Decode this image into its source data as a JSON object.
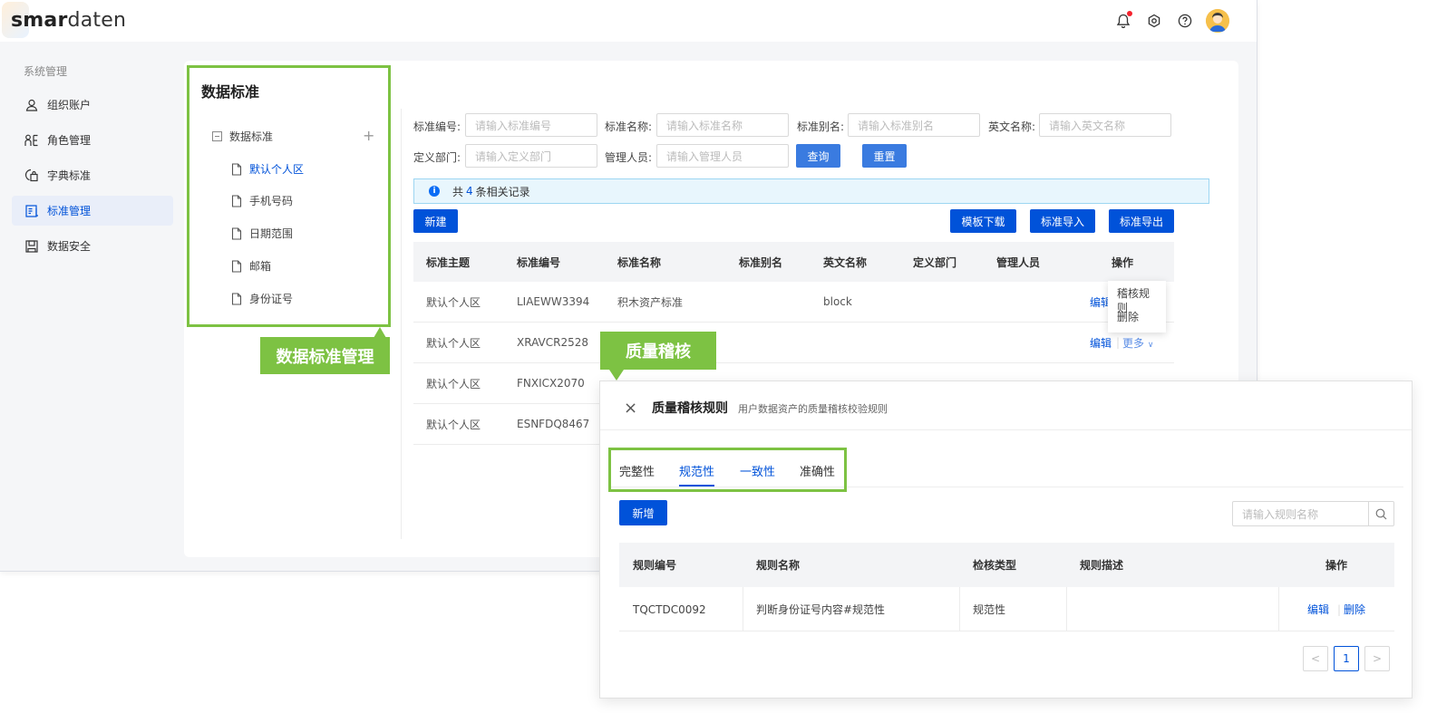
{
  "app": {
    "logo_bold": "sm",
    "logo_mid": "ar",
    "logo_light": "daten"
  },
  "topbar": {
    "icons": [
      "bell-icon",
      "settings-icon",
      "help-icon",
      "user-avatar"
    ]
  },
  "sidebar": {
    "section_title": "系统管理",
    "items": [
      {
        "label": "组织账户",
        "icon": "user-icon"
      },
      {
        "label": "角色管理",
        "icon": "role-icon"
      },
      {
        "label": "字典标准",
        "icon": "dictionary-icon"
      },
      {
        "label": "标准管理",
        "icon": "standard-icon",
        "active": true
      },
      {
        "label": "数据安全",
        "icon": "security-icon"
      }
    ]
  },
  "tree": {
    "title": "数据标准",
    "root": "数据标准",
    "add_symbol": "+",
    "leaves": [
      "默认个人区",
      "手机号码",
      "日期范围",
      "邮箱",
      "身份证号"
    ]
  },
  "callouts": {
    "data_standard_mgmt": "数据标准管理",
    "quality_check": "质量稽核"
  },
  "form": {
    "labels": [
      "标准编号:",
      "标准名称:",
      "标准别名:",
      "英文名称:",
      "定义部门:",
      "管理人员:"
    ],
    "placeholders": [
      "请输入标准编号",
      "请输入标准名称",
      "请输入标准别名",
      "请输入英文名称",
      "请输入定义部门",
      "请输入管理人员"
    ],
    "query": "查询",
    "reset": "重置"
  },
  "alert": {
    "prefix": "共",
    "count": "4",
    "suffix": "条相关记录",
    "icon": "info-icon"
  },
  "toolbar": {
    "new": "新建",
    "template_download": "模板下载",
    "import": "标准导入",
    "export": "标准导出"
  },
  "main_table": {
    "columns": [
      "标准主题",
      "标准编号",
      "标准名称",
      "标准别名",
      "英文名称",
      "定义部门",
      "管理人员",
      "操作"
    ],
    "rows": [
      {
        "topic": "默认个人区",
        "code": "LIAEWW3394",
        "name": "积木资产标准",
        "en": "block"
      },
      {
        "topic": "默认个人区",
        "code": "XRAVCR2528",
        "name": "",
        "en": ""
      },
      {
        "topic": "默认个人区",
        "code": "FNXICX2070",
        "name": "",
        "en": ""
      },
      {
        "topic": "默认个人区",
        "code": "ESNFDQ8467",
        "name": "",
        "en": ""
      }
    ],
    "edit": "编辑",
    "more": "更多",
    "more_menu": [
      "稽核规则",
      "删除"
    ]
  },
  "dialog": {
    "close": "×",
    "title": "质量稽核规则",
    "subtitle": "用户数据资产的质量稽核校验规则",
    "tabs": [
      "完整性",
      "规范性",
      "一致性",
      "准确性"
    ],
    "active_tab": "规范性",
    "add": "新增",
    "search_placeholder": "请输入规则名称",
    "columns": [
      "规则编号",
      "规则名称",
      "检核类型",
      "规则描述",
      "操作"
    ],
    "rows": [
      {
        "code": "TQCTDC0092",
        "name": "判断身份证号内容#规范性",
        "type": "规范性",
        "desc": ""
      }
    ],
    "edit": "编辑",
    "delete": "删除",
    "pager": {
      "prev": "<",
      "page": "1",
      "next": ">"
    }
  },
  "colors": {
    "primary": "#0052d9",
    "highlight": "#7dc243",
    "alert_bg": "#e8f6fd"
  }
}
